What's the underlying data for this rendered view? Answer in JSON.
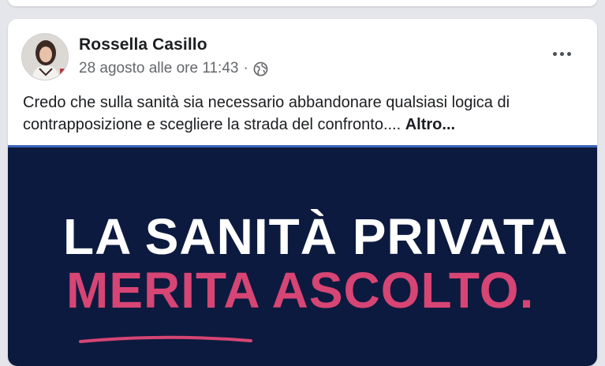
{
  "post": {
    "author_name": "Rossella Casillo",
    "timestamp": "28 agosto alle ore 11:43",
    "separator": "·",
    "privacy_icon": "globe-icon",
    "more_icon": "more-options-icon",
    "text": "Credo che sulla sanità sia necessario abbandonare qualsiasi logica di contrapposizione e scegliere la strada del confronto....",
    "see_more_label": "Altro..."
  },
  "image": {
    "line1": "LA SANITÀ PRIVATA",
    "line2": "MERITA ASCOLTO."
  },
  "colors": {
    "page_background": "#e4e6eb",
    "card_background": "#ffffff",
    "graphic_background": "#0d1a3f",
    "graphic_accent": "#d64574",
    "divider_blue": "#3b63b8",
    "secondary_text": "#65676b"
  }
}
